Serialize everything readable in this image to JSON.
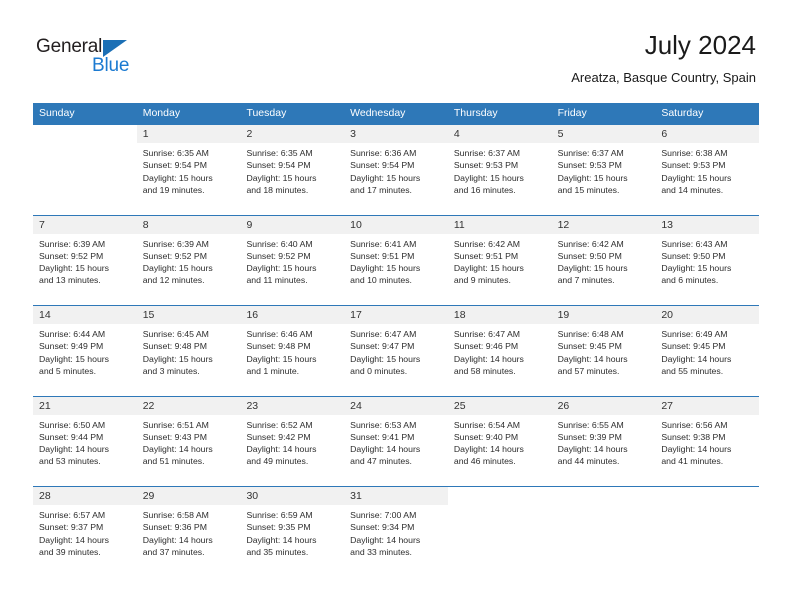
{
  "brand": {
    "word_one": "General",
    "word_two": "Blue",
    "triangle_color": "#1b6fb5",
    "blue_color": "#1b7ad1"
  },
  "header": {
    "title": "July 2024",
    "subtitle": "Areatza, Basque Country, Spain"
  },
  "theme": {
    "header_blue": "#2e78b8",
    "daynum_band": "#f1f1f1",
    "text": "#2d2d2d"
  },
  "weekdays": [
    "Sunday",
    "Monday",
    "Tuesday",
    "Wednesday",
    "Thursday",
    "Friday",
    "Saturday"
  ],
  "labels": {
    "sunrise_prefix": "Sunrise:",
    "sunset_prefix": "Sunset:",
    "daylight_prefix": "Daylight:"
  },
  "weeks": [
    [
      {
        "day": "",
        "sunrise": "",
        "sunset": "",
        "daylight_line1": "",
        "daylight_line2": ""
      },
      {
        "day": "1",
        "sunrise": "Sunrise: 6:35 AM",
        "sunset": "Sunset: 9:54 PM",
        "daylight_line1": "Daylight: 15 hours",
        "daylight_line2": "and 19 minutes."
      },
      {
        "day": "2",
        "sunrise": "Sunrise: 6:35 AM",
        "sunset": "Sunset: 9:54 PM",
        "daylight_line1": "Daylight: 15 hours",
        "daylight_line2": "and 18 minutes."
      },
      {
        "day": "3",
        "sunrise": "Sunrise: 6:36 AM",
        "sunset": "Sunset: 9:54 PM",
        "daylight_line1": "Daylight: 15 hours",
        "daylight_line2": "and 17 minutes."
      },
      {
        "day": "4",
        "sunrise": "Sunrise: 6:37 AM",
        "sunset": "Sunset: 9:53 PM",
        "daylight_line1": "Daylight: 15 hours",
        "daylight_line2": "and 16 minutes."
      },
      {
        "day": "5",
        "sunrise": "Sunrise: 6:37 AM",
        "sunset": "Sunset: 9:53 PM",
        "daylight_line1": "Daylight: 15 hours",
        "daylight_line2": "and 15 minutes."
      },
      {
        "day": "6",
        "sunrise": "Sunrise: 6:38 AM",
        "sunset": "Sunset: 9:53 PM",
        "daylight_line1": "Daylight: 15 hours",
        "daylight_line2": "and 14 minutes."
      }
    ],
    [
      {
        "day": "7",
        "sunrise": "Sunrise: 6:39 AM",
        "sunset": "Sunset: 9:52 PM",
        "daylight_line1": "Daylight: 15 hours",
        "daylight_line2": "and 13 minutes."
      },
      {
        "day": "8",
        "sunrise": "Sunrise: 6:39 AM",
        "sunset": "Sunset: 9:52 PM",
        "daylight_line1": "Daylight: 15 hours",
        "daylight_line2": "and 12 minutes."
      },
      {
        "day": "9",
        "sunrise": "Sunrise: 6:40 AM",
        "sunset": "Sunset: 9:52 PM",
        "daylight_line1": "Daylight: 15 hours",
        "daylight_line2": "and 11 minutes."
      },
      {
        "day": "10",
        "sunrise": "Sunrise: 6:41 AM",
        "sunset": "Sunset: 9:51 PM",
        "daylight_line1": "Daylight: 15 hours",
        "daylight_line2": "and 10 minutes."
      },
      {
        "day": "11",
        "sunrise": "Sunrise: 6:42 AM",
        "sunset": "Sunset: 9:51 PM",
        "daylight_line1": "Daylight: 15 hours",
        "daylight_line2": "and 9 minutes."
      },
      {
        "day": "12",
        "sunrise": "Sunrise: 6:42 AM",
        "sunset": "Sunset: 9:50 PM",
        "daylight_line1": "Daylight: 15 hours",
        "daylight_line2": "and 7 minutes."
      },
      {
        "day": "13",
        "sunrise": "Sunrise: 6:43 AM",
        "sunset": "Sunset: 9:50 PM",
        "daylight_line1": "Daylight: 15 hours",
        "daylight_line2": "and 6 minutes."
      }
    ],
    [
      {
        "day": "14",
        "sunrise": "Sunrise: 6:44 AM",
        "sunset": "Sunset: 9:49 PM",
        "daylight_line1": "Daylight: 15 hours",
        "daylight_line2": "and 5 minutes."
      },
      {
        "day": "15",
        "sunrise": "Sunrise: 6:45 AM",
        "sunset": "Sunset: 9:48 PM",
        "daylight_line1": "Daylight: 15 hours",
        "daylight_line2": "and 3 minutes."
      },
      {
        "day": "16",
        "sunrise": "Sunrise: 6:46 AM",
        "sunset": "Sunset: 9:48 PM",
        "daylight_line1": "Daylight: 15 hours",
        "daylight_line2": "and 1 minute."
      },
      {
        "day": "17",
        "sunrise": "Sunrise: 6:47 AM",
        "sunset": "Sunset: 9:47 PM",
        "daylight_line1": "Daylight: 15 hours",
        "daylight_line2": "and 0 minutes."
      },
      {
        "day": "18",
        "sunrise": "Sunrise: 6:47 AM",
        "sunset": "Sunset: 9:46 PM",
        "daylight_line1": "Daylight: 14 hours",
        "daylight_line2": "and 58 minutes."
      },
      {
        "day": "19",
        "sunrise": "Sunrise: 6:48 AM",
        "sunset": "Sunset: 9:45 PM",
        "daylight_line1": "Daylight: 14 hours",
        "daylight_line2": "and 57 minutes."
      },
      {
        "day": "20",
        "sunrise": "Sunrise: 6:49 AM",
        "sunset": "Sunset: 9:45 PM",
        "daylight_line1": "Daylight: 14 hours",
        "daylight_line2": "and 55 minutes."
      }
    ],
    [
      {
        "day": "21",
        "sunrise": "Sunrise: 6:50 AM",
        "sunset": "Sunset: 9:44 PM",
        "daylight_line1": "Daylight: 14 hours",
        "daylight_line2": "and 53 minutes."
      },
      {
        "day": "22",
        "sunrise": "Sunrise: 6:51 AM",
        "sunset": "Sunset: 9:43 PM",
        "daylight_line1": "Daylight: 14 hours",
        "daylight_line2": "and 51 minutes."
      },
      {
        "day": "23",
        "sunrise": "Sunrise: 6:52 AM",
        "sunset": "Sunset: 9:42 PM",
        "daylight_line1": "Daylight: 14 hours",
        "daylight_line2": "and 49 minutes."
      },
      {
        "day": "24",
        "sunrise": "Sunrise: 6:53 AM",
        "sunset": "Sunset: 9:41 PM",
        "daylight_line1": "Daylight: 14 hours",
        "daylight_line2": "and 47 minutes."
      },
      {
        "day": "25",
        "sunrise": "Sunrise: 6:54 AM",
        "sunset": "Sunset: 9:40 PM",
        "daylight_line1": "Daylight: 14 hours",
        "daylight_line2": "and 46 minutes."
      },
      {
        "day": "26",
        "sunrise": "Sunrise: 6:55 AM",
        "sunset": "Sunset: 9:39 PM",
        "daylight_line1": "Daylight: 14 hours",
        "daylight_line2": "and 44 minutes."
      },
      {
        "day": "27",
        "sunrise": "Sunrise: 6:56 AM",
        "sunset": "Sunset: 9:38 PM",
        "daylight_line1": "Daylight: 14 hours",
        "daylight_line2": "and 41 minutes."
      }
    ],
    [
      {
        "day": "28",
        "sunrise": "Sunrise: 6:57 AM",
        "sunset": "Sunset: 9:37 PM",
        "daylight_line1": "Daylight: 14 hours",
        "daylight_line2": "and 39 minutes."
      },
      {
        "day": "29",
        "sunrise": "Sunrise: 6:58 AM",
        "sunset": "Sunset: 9:36 PM",
        "daylight_line1": "Daylight: 14 hours",
        "daylight_line2": "and 37 minutes."
      },
      {
        "day": "30",
        "sunrise": "Sunrise: 6:59 AM",
        "sunset": "Sunset: 9:35 PM",
        "daylight_line1": "Daylight: 14 hours",
        "daylight_line2": "and 35 minutes."
      },
      {
        "day": "31",
        "sunrise": "Sunrise: 7:00 AM",
        "sunset": "Sunset: 9:34 PM",
        "daylight_line1": "Daylight: 14 hours",
        "daylight_line2": "and 33 minutes."
      },
      {
        "day": "",
        "sunrise": "",
        "sunset": "",
        "daylight_line1": "",
        "daylight_line2": ""
      },
      {
        "day": "",
        "sunrise": "",
        "sunset": "",
        "daylight_line1": "",
        "daylight_line2": ""
      },
      {
        "day": "",
        "sunrise": "",
        "sunset": "",
        "daylight_line1": "",
        "daylight_line2": ""
      }
    ]
  ]
}
